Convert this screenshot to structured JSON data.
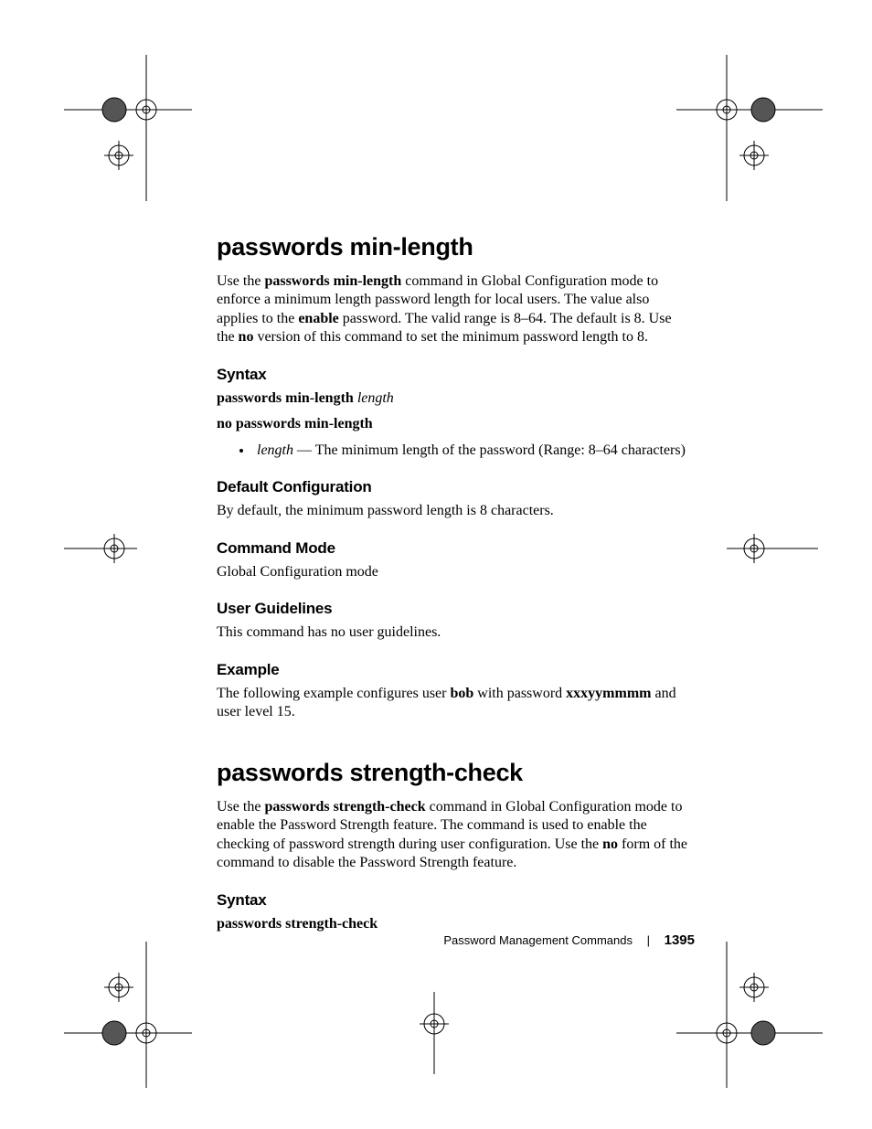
{
  "section1": {
    "title": "passwords min-length",
    "intro_parts": {
      "p1": "Use the ",
      "b1": "passwords min-length",
      "p2": " command in Global Configuration mode to enforce a minimum length password length for local users. The value also applies to the ",
      "b2": "enable",
      "p3": " password. The valid range is 8–64. The default is 8. Use the ",
      "b3": "no",
      "p4": " version of this command to set the minimum password length to 8."
    },
    "syntax_heading": "Syntax",
    "syntax_line1_b": "passwords min-length",
    "syntax_line1_i": "length",
    "syntax_line2_b": "no passwords min-length",
    "bullet_i": "length",
    "bullet_rest": " — The minimum length of the password (Range: 8–64 characters)",
    "defconf_heading": "Default Configuration",
    "defconf_text": "By default, the minimum password length is 8 characters.",
    "cmdmode_heading": "Command Mode",
    "cmdmode_text": "Global Configuration mode",
    "guidelines_heading": "User Guidelines",
    "guidelines_text": "This command has no user guidelines.",
    "example_heading": "Example",
    "example_parts": {
      "p1": "The following example configures user ",
      "b1": "bob",
      "p2": " with password ",
      "b2": "xxxyymmmm",
      "p3": " and user level 15."
    }
  },
  "section2": {
    "title": "passwords strength-check",
    "intro_parts": {
      "p1": "Use the ",
      "b1": "passwords strength-check",
      "p2": " command in Global Configuration mode to enable the Password Strength feature. The command is used to enable the checking of password strength during user configuration. Use the ",
      "b2": "no",
      "p3": " form of the command to disable the Password Strength feature."
    },
    "syntax_heading": "Syntax",
    "syntax_line1_b": "passwords strength-check"
  },
  "footer": {
    "section_name": "Password Management Commands",
    "page_number": "1395"
  }
}
